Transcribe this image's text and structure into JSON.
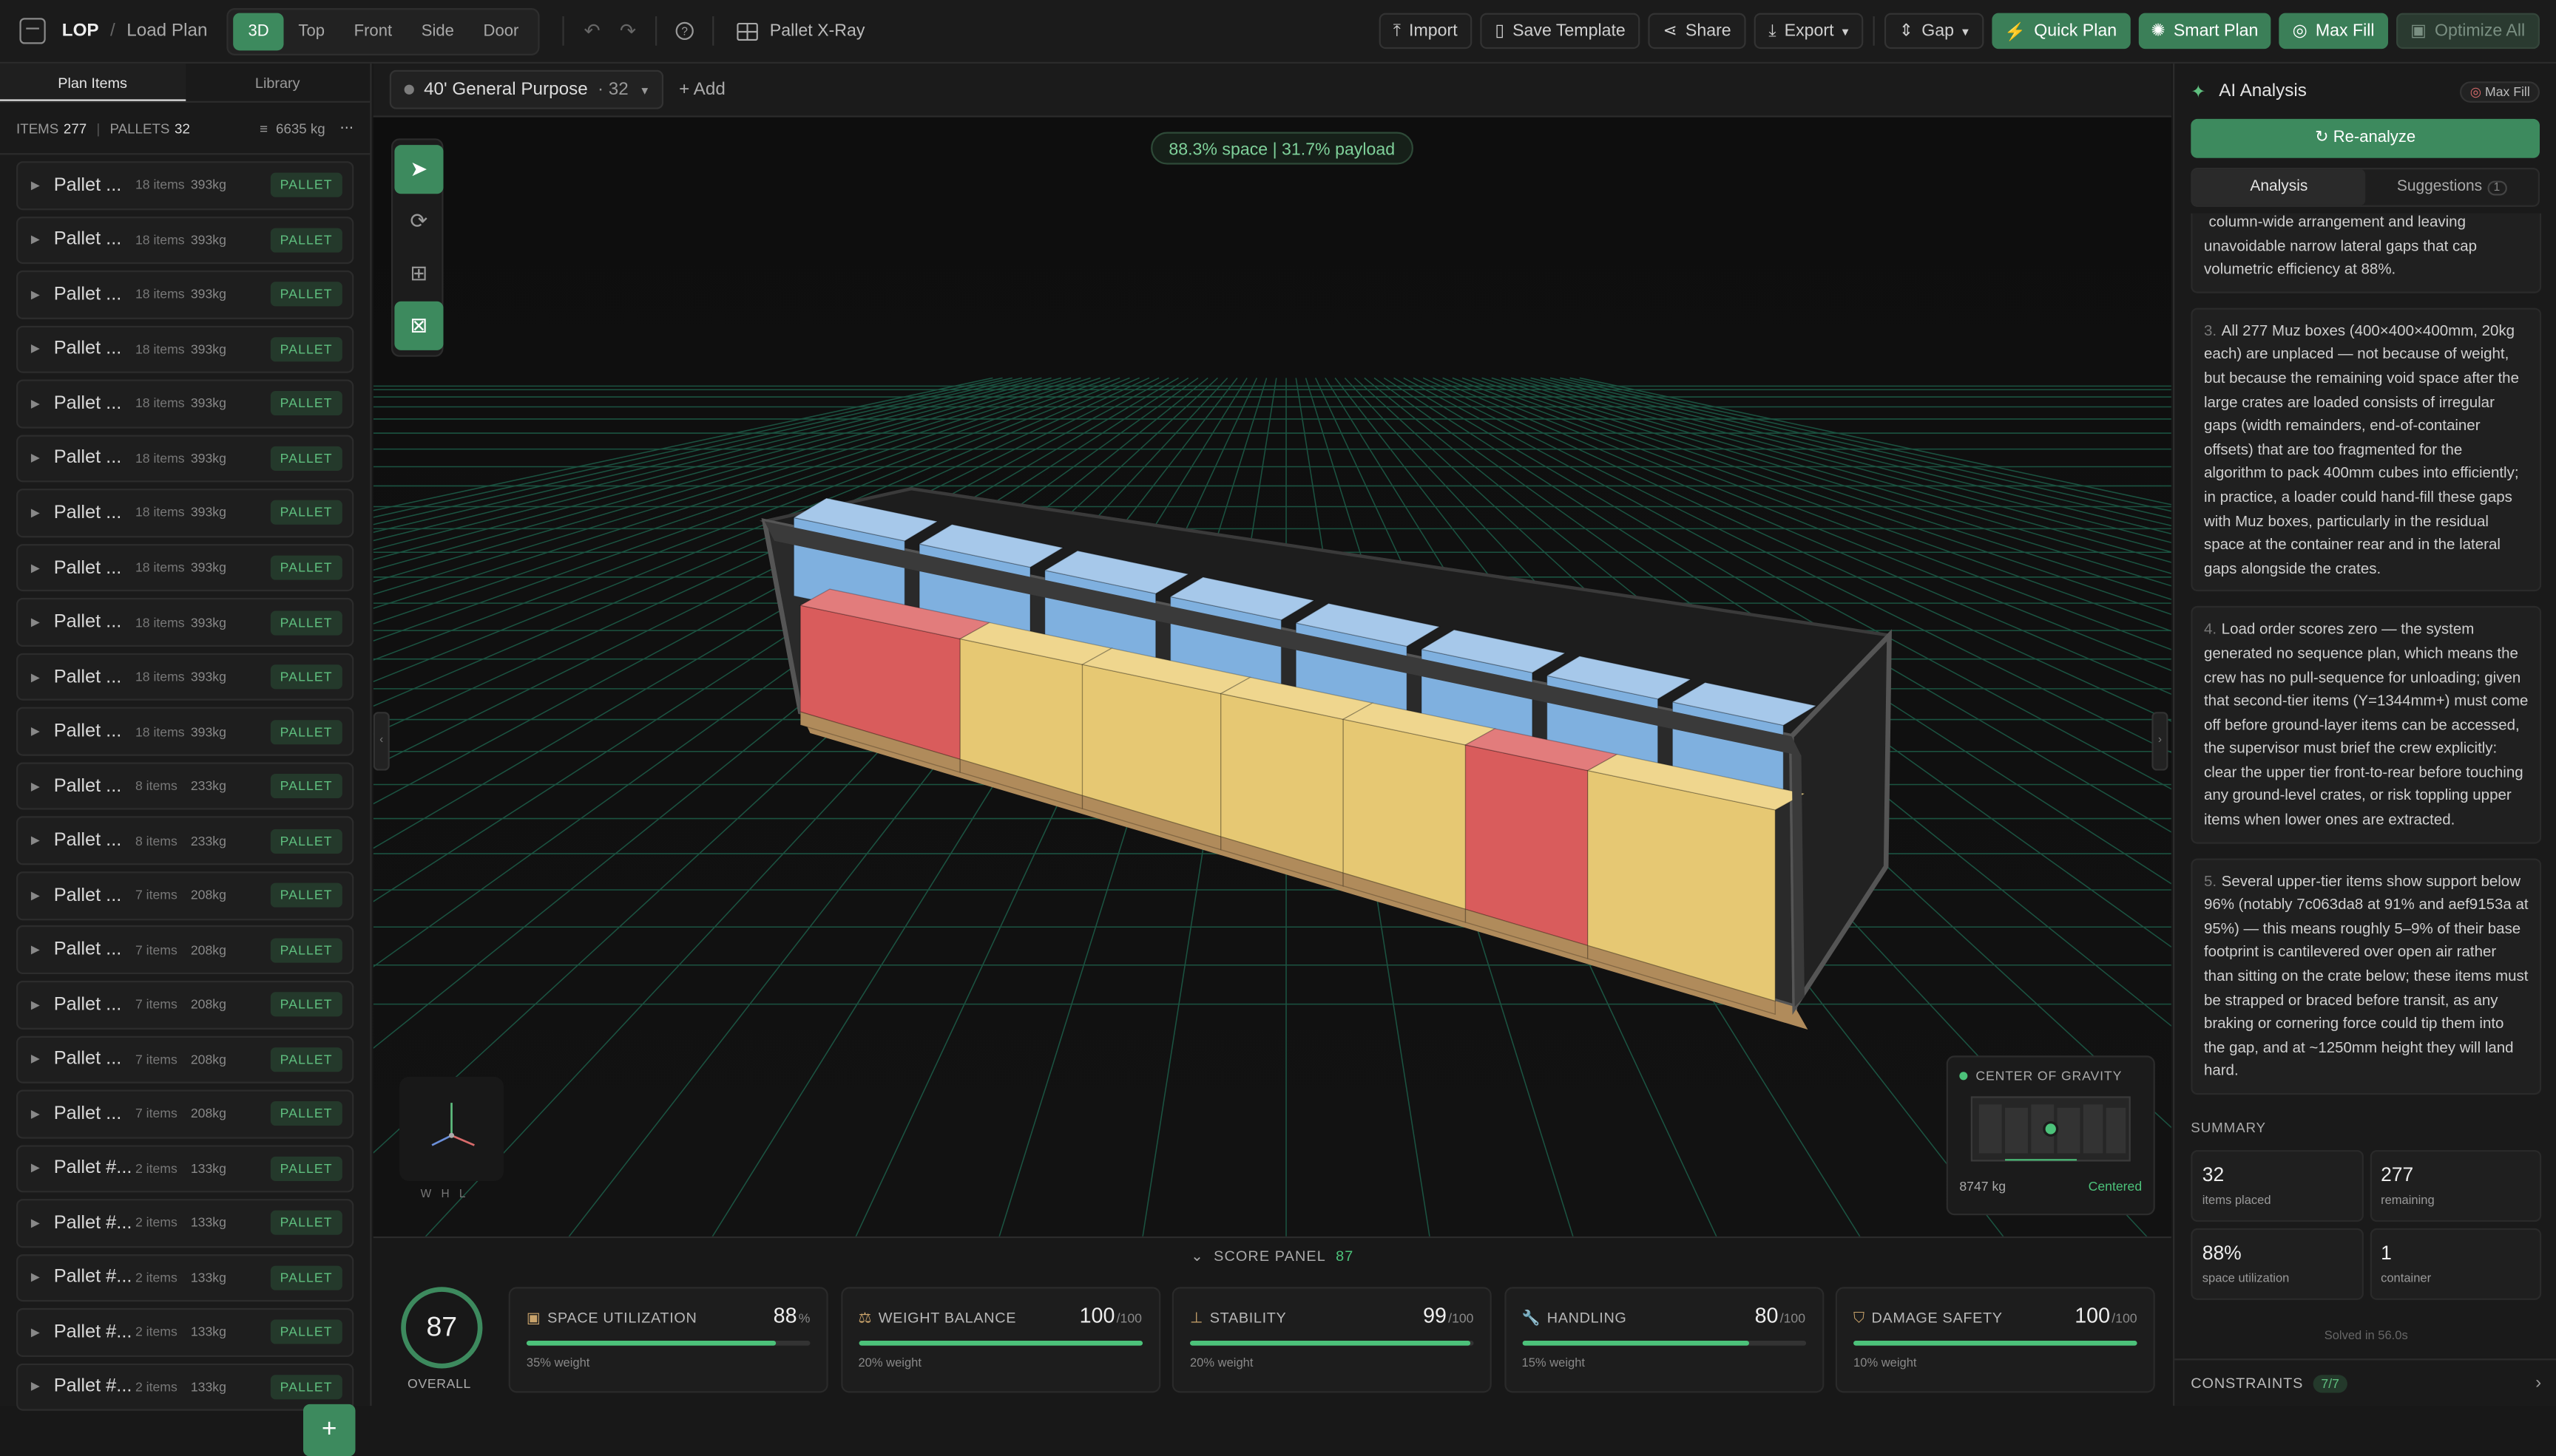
{
  "breadcrumb": {
    "root": "LOP",
    "page": "Load Plan"
  },
  "view_modes": [
    "3D",
    "Top",
    "Front",
    "Side",
    "Door"
  ],
  "active_view": "3D",
  "xray_label": "Pallet X-Ray",
  "toolbar": {
    "import": "Import",
    "save_template": "Save Template",
    "share": "Share",
    "export": "Export",
    "gap": "Gap",
    "quick_plan": "Quick Plan",
    "smart_plan": "Smart Plan",
    "max_fill": "Max Fill",
    "optimize_all": "Optimize All"
  },
  "left_panel": {
    "tabs": [
      "Plan Items",
      "Library"
    ],
    "items_label": "ITEMS",
    "items_count": "277",
    "pallets_label": "PALLETS",
    "pallets_count": "32",
    "total_weight": "6635 kg",
    "pallets": [
      {
        "name": "Pallet ...",
        "items": "18 items",
        "weight": "393kg",
        "tag": "PALLET"
      },
      {
        "name": "Pallet ...",
        "items": "18 items",
        "weight": "393kg",
        "tag": "PALLET"
      },
      {
        "name": "Pallet ...",
        "items": "18 items",
        "weight": "393kg",
        "tag": "PALLET"
      },
      {
        "name": "Pallet ...",
        "items": "18 items",
        "weight": "393kg",
        "tag": "PALLET"
      },
      {
        "name": "Pallet ...",
        "items": "18 items",
        "weight": "393kg",
        "tag": "PALLET"
      },
      {
        "name": "Pallet ...",
        "items": "18 items",
        "weight": "393kg",
        "tag": "PALLET"
      },
      {
        "name": "Pallet ...",
        "items": "18 items",
        "weight": "393kg",
        "tag": "PALLET"
      },
      {
        "name": "Pallet ...",
        "items": "18 items",
        "weight": "393kg",
        "tag": "PALLET"
      },
      {
        "name": "Pallet ...",
        "items": "18 items",
        "weight": "393kg",
        "tag": "PALLET"
      },
      {
        "name": "Pallet ...",
        "items": "18 items",
        "weight": "393kg",
        "tag": "PALLET"
      },
      {
        "name": "Pallet ...",
        "items": "18 items",
        "weight": "393kg",
        "tag": "PALLET"
      },
      {
        "name": "Pallet ...",
        "items": "8 items",
        "weight": "233kg",
        "tag": "PALLET"
      },
      {
        "name": "Pallet ...",
        "items": "8 items",
        "weight": "233kg",
        "tag": "PALLET"
      },
      {
        "name": "Pallet ...",
        "items": "7 items",
        "weight": "208kg",
        "tag": "PALLET"
      },
      {
        "name": "Pallet ...",
        "items": "7 items",
        "weight": "208kg",
        "tag": "PALLET"
      },
      {
        "name": "Pallet ...",
        "items": "7 items",
        "weight": "208kg",
        "tag": "PALLET"
      },
      {
        "name": "Pallet ...",
        "items": "7 items",
        "weight": "208kg",
        "tag": "PALLET"
      },
      {
        "name": "Pallet ...",
        "items": "7 items",
        "weight": "208kg",
        "tag": "PALLET"
      },
      {
        "name": "Pallet #...",
        "items": "2 items",
        "weight": "133kg",
        "tag": "PALLET"
      },
      {
        "name": "Pallet #...",
        "items": "2 items",
        "weight": "133kg",
        "tag": "PALLET"
      },
      {
        "name": "Pallet #...",
        "items": "2 items",
        "weight": "133kg",
        "tag": "PALLET"
      },
      {
        "name": "Pallet #...",
        "items": "2 items",
        "weight": "133kg",
        "tag": "PALLET"
      },
      {
        "name": "Pallet #...",
        "items": "2 items",
        "weight": "133kg",
        "tag": "PALLET"
      }
    ]
  },
  "container": {
    "name": "40' General Purpose",
    "count": "· 32",
    "add": "Add"
  },
  "viewport": {
    "stats_chip": "88.3% space | 31.7% payload",
    "axis_labels": [
      "W",
      "H",
      "L"
    ],
    "cog": {
      "title": "CENTER OF GRAVITY",
      "weight": "8747 kg",
      "status": "Centered"
    }
  },
  "score_panel": {
    "title": "SCORE PANEL",
    "total": "87",
    "overall": "87",
    "overall_label": "OVERALL",
    "cards": [
      {
        "icon": "cube-icon",
        "label": "SPACE UTILIZATION",
        "value": "88",
        "unit": "%",
        "weight": "35% weight",
        "fill": 88
      },
      {
        "icon": "scale-icon",
        "label": "WEIGHT BALANCE",
        "value": "100",
        "unit": "/100",
        "weight": "20% weight",
        "fill": 100
      },
      {
        "icon": "stability-icon",
        "label": "STABILITY",
        "value": "99",
        "unit": "/100",
        "weight": "20% weight",
        "fill": 99
      },
      {
        "icon": "wrench-icon",
        "label": "HANDLING",
        "value": "80",
        "unit": "/100",
        "weight": "15% weight",
        "fill": 80
      },
      {
        "icon": "shield-icon",
        "label": "DAMAGE SAFETY",
        "value": "100",
        "unit": "/100",
        "weight": "10% weight",
        "fill": 100
      }
    ]
  },
  "ai_panel": {
    "title": "AI Analysis",
    "badge": "Max Fill",
    "reanalyze": "↻ Re-analyze",
    "tabs": [
      "Analysis",
      "Suggestions"
    ],
    "suggestions_count": "1",
    "paragraphs": [
      {
        "num": "",
        "text": "column-wide arrangement and leaving unavoidable narrow lateral gaps that cap volumetric efficiency at 88%."
      },
      {
        "num": "3.",
        "text": "All 277 Muz boxes (400×400×400mm, 20kg each) are unplaced — not because of weight, but because the remaining void space after the large crates are loaded consists of irregular gaps (width remainders, end-of-container offsets) that are too fragmented for the algorithm to pack 400mm cubes into efficiently; in practice, a loader could hand-fill these gaps with Muz boxes, particularly in the residual space at the container rear and in the lateral gaps alongside the crates."
      },
      {
        "num": "4.",
        "text": "Load order scores zero — the system generated no sequence plan, which means the crew has no pull-sequence for unloading; given that second-tier items (Y=1344mm+) must come off before ground-layer items can be accessed, the supervisor must brief the crew explicitly: clear the upper tier front-to-rear before touching any ground-level crates, or risk toppling upper items when lower ones are extracted."
      },
      {
        "num": "5.",
        "text": "Several upper-tier items show support below 96% (notably 7c063da8 at 91% and aef9153a at 95%) — this means roughly 5–9% of their base footprint is cantilevered over open air rather than sitting on the crate below; these items must be strapped or braced before transit, as any braking or cornering force could tip them into the gap, and at ~1250mm height they will land hard."
      }
    ],
    "summary_label": "SUMMARY",
    "summary": [
      {
        "value": "32",
        "label": "items placed"
      },
      {
        "value": "277",
        "label": "remaining"
      },
      {
        "value": "88%",
        "label": "space utilization"
      },
      {
        "value": "1",
        "label": "container"
      }
    ],
    "solved": "Solved in 56.0s",
    "constraints_label": "CONSTRAINTS",
    "constraints_count": "7/7"
  },
  "colors": {
    "accent": "#3d8a5e",
    "good": "#4cc27a",
    "crate_yellow": "#e6c873",
    "crate_red": "#d95c5c",
    "crate_blue": "#7fb0df"
  }
}
